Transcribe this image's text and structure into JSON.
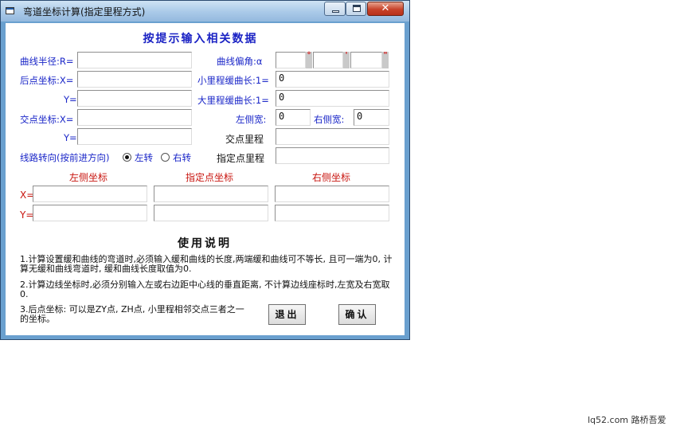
{
  "window": {
    "title": "弯道坐标计算(指定里程方式)",
    "close_glyph": "✕"
  },
  "header": "按提示输入相关数据",
  "labels": {
    "radius": "曲线半径:R=",
    "back_x": "后点坐标:X=",
    "back_y": "Y=",
    "intersect_x": "交点坐标:X=",
    "intersect_y": "Y=",
    "turn_dir": "线路转向(按前进方向)",
    "turn_left": "左转",
    "turn_right": "右转",
    "deflection": "曲线偏角:α",
    "small_spiral": "小里程缓曲长:1=",
    "large_spiral": "大里程缓曲长:1=",
    "left_width": "左侧宽:",
    "right_width": "右侧宽:",
    "intersect_mileage": "交点里程",
    "target_mileage": "指定点里程",
    "left_coord": "左侧坐标",
    "target_coord": "指定点坐标",
    "right_coord": "右侧坐标",
    "res_x": "X=",
    "res_y": "Y="
  },
  "angle_marks": {
    "deg": "°",
    "min": "'",
    "sec": "\""
  },
  "values": {
    "radius": "",
    "back_x": "",
    "back_y": "",
    "intersect_x": "",
    "intersect_y": "",
    "deg": "",
    "min": "",
    "sec": "",
    "small_spiral": "0",
    "large_spiral": "0",
    "left_width": "0",
    "right_width": "0",
    "intersect_mileage": "",
    "target_mileage": ""
  },
  "turn_selected": "left",
  "usage": {
    "title": "使用说明",
    "note1": "1.计算设置缓和曲线的弯道时,必须输入缓和曲线的长度,两端缓和曲线可不等长, 且可一端为0, 计算无缓和曲线弯道时, 缓和曲线长度取值为0.",
    "note2": "2.计算边线坐标时,必须分别输入左或右边距中心线的垂直距离, 不计算边线座标时,左宽及右宽取0.",
    "note3": "3.后点坐标: 可以是ZY点, ZH点, 小里程相邻交点三者之一的坐标。"
  },
  "buttons": {
    "exit": "退出",
    "confirm": "确认"
  },
  "watermark": "lq52.com 路桥吾爱"
}
